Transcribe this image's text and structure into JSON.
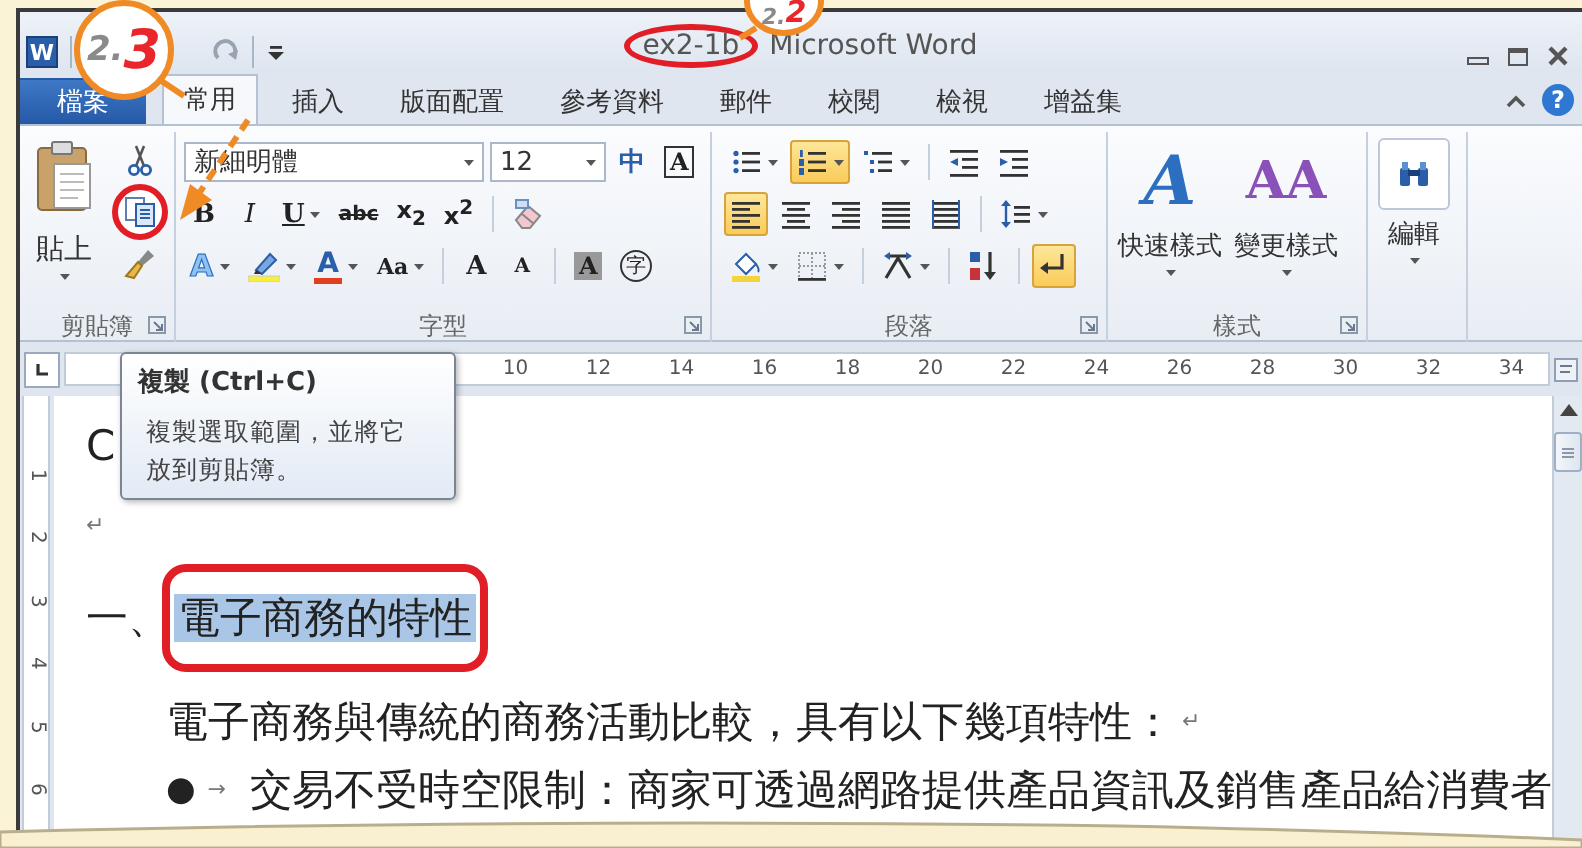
{
  "callouts": [
    {
      "step": "2.",
      "sub": "3"
    },
    {
      "step": "2.",
      "sub": "2"
    }
  ],
  "quick_access": {
    "app_letter": "W"
  },
  "window": {
    "document": "ex2-1b",
    "app": "Microsoft Word",
    "document_circled": true
  },
  "tabs": [
    {
      "label": "檔案",
      "kind": "file",
      "selected": false
    },
    {
      "label": "常用",
      "kind": "tab",
      "selected": true
    },
    {
      "label": "插入",
      "kind": "tab",
      "selected": false
    },
    {
      "label": "版面配置",
      "kind": "tab",
      "selected": false
    },
    {
      "label": "參考資料",
      "kind": "tab",
      "selected": false
    },
    {
      "label": "郵件",
      "kind": "tab",
      "selected": false
    },
    {
      "label": "校閱",
      "kind": "tab",
      "selected": false
    },
    {
      "label": "檢視",
      "kind": "tab",
      "selected": false
    },
    {
      "label": "增益集",
      "kind": "tab",
      "selected": false
    }
  ],
  "help": "?",
  "clipboard": {
    "title": "剪貼簿",
    "paste": "貼上",
    "copy_circled": true
  },
  "font": {
    "title": "字型",
    "rows": [
      {
        "buttons": [
          {
            "kind": "font_name",
            "value": "新細明體",
            "dropdown": true
          },
          {
            "kind": "font_size",
            "value": "12",
            "dropdown": true
          },
          {
            "kind": "phonetic",
            "glyph": "中",
            "on": false
          },
          {
            "kind": "border",
            "glyph": "A",
            "on": false
          }
        ]
      },
      {
        "buttons": [
          {
            "kind": "bold",
            "glyph": "B",
            "on": false
          },
          {
            "kind": "italic",
            "glyph": "I",
            "on": false
          },
          {
            "kind": "underline",
            "glyph": "U",
            "on": false,
            "dropdown": true
          },
          {
            "kind": "strike",
            "glyph": "abc",
            "on": false
          },
          {
            "kind": "subscript",
            "glyph": "x$_{2}$",
            "on": false
          },
          {
            "kind": "superscript",
            "glyph": "x$^{2}$",
            "on": false
          },
          {
            "kind": "sep"
          },
          {
            "kind": "clear",
            "on": false
          }
        ]
      },
      {
        "buttons": [
          {
            "kind": "effects",
            "glyph": "A",
            "on": false,
            "dropdown": true
          },
          {
            "kind": "highlight",
            "on": false,
            "dropdown": true
          },
          {
            "kind": "font_color",
            "glyph": "A",
            "on": false,
            "dropdown": true
          },
          {
            "kind": "case",
            "glyph": "Aa",
            "on": false,
            "dropdown": true
          },
          {
            "kind": "sep"
          },
          {
            "kind": "grow",
            "glyph": "A",
            "on": false
          },
          {
            "kind": "shrink",
            "glyph": "A",
            "on": false
          },
          {
            "kind": "sep"
          },
          {
            "kind": "shading",
            "glyph": "A",
            "on": false
          },
          {
            "kind": "enclose",
            "glyph": "字",
            "on": false
          }
        ]
      }
    ]
  },
  "paragraph": {
    "title": "段落",
    "rows": [
      {
        "buttons": [
          {
            "kind": "bullets",
            "on": false,
            "dropdown": true
          },
          {
            "kind": "numbering",
            "on": true,
            "dropdown": true
          },
          {
            "kind": "multilevel",
            "on": false,
            "dropdown": true
          },
          {
            "kind": "sep"
          },
          {
            "kind": "outdent",
            "on": false
          },
          {
            "kind": "indent",
            "on": false
          }
        ]
      },
      {
        "buttons": [
          {
            "kind": "align_left",
            "on": true
          },
          {
            "kind": "center",
            "on": false
          },
          {
            "kind": "align_right",
            "on": false
          },
          {
            "kind": "justify",
            "on": false
          },
          {
            "kind": "distributed",
            "on": false
          },
          {
            "kind": "sep"
          },
          {
            "kind": "line_spacing",
            "on": false,
            "dropdown": true
          }
        ]
      },
      {
        "buttons": [
          {
            "kind": "shading",
            "on": false,
            "dropdown": true
          },
          {
            "kind": "borders",
            "on": false,
            "dropdown": true
          },
          {
            "kind": "sep"
          },
          {
            "kind": "asian",
            "on": false,
            "dropdown": true
          },
          {
            "kind": "sep"
          },
          {
            "kind": "sort",
            "on": false
          },
          {
            "kind": "sep"
          },
          {
            "kind": "marks",
            "on": true
          }
        ]
      }
    ]
  },
  "styles": {
    "title": "樣式",
    "items": [
      {
        "kind": "quick",
        "glyph": "A",
        "label": "快速樣式"
      },
      {
        "kind": "change",
        "glyph": "AA",
        "label": "變更樣式"
      }
    ]
  },
  "editing": {
    "label": "編輯"
  },
  "tooltip": {
    "title": "複製 (Ctrl+C)",
    "body_lines": [
      "複製選取範圍，並將它",
      "放到剪貼簿。"
    ]
  },
  "ruler": {
    "marks": [
      "10",
      "12",
      "14",
      "16",
      "18",
      "20",
      "22",
      "24",
      "26",
      "28",
      "30",
      "32",
      "34"
    ]
  },
  "vertical_ruler": {
    "marks": [
      "1",
      "2",
      "3",
      "4",
      "5",
      "6"
    ]
  },
  "document": {
    "paragraphs": [
      {
        "kind": "plain",
        "text": "C"
      },
      {
        "kind": "empty",
        "mark": "↵"
      },
      {
        "kind": "heading",
        "number": "一、",
        "text": "電子商務的特性",
        "selected": true,
        "circled": true
      },
      {
        "kind": "body",
        "text": "電子商務與傳統的商務活動比較，具有以下幾項特性：",
        "mark": "↵"
      },
      {
        "kind": "bullet",
        "bullet": "●",
        "tab": "→",
        "text": "交易不受時空限制：商家可透過網路提供產品資訊及銷售產品給消費者"
      }
    ]
  }
}
